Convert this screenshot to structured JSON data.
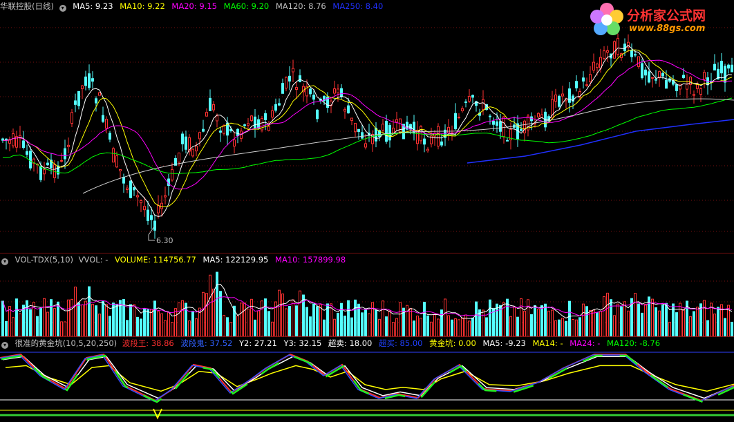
{
  "price_pane": {
    "title": "华联控股(日线)",
    "ma_labels": [
      {
        "text": "MA5: 9.23",
        "color": "#ffffff"
      },
      {
        "text": "MA10: 9.22",
        "color": "#ffff00"
      },
      {
        "text": "MA20: 9.15",
        "color": "#ff00ff"
      },
      {
        "text": "MA60: 9.20",
        "color": "#00ff00"
      },
      {
        "text": "MA120: 8.76",
        "color": "#c0c0c0"
      },
      {
        "text": "MA250: 8.40",
        "color": "#0000ff"
      }
    ],
    "low_marker": "6.30"
  },
  "logo": {
    "name": "分析家公式网",
    "url": "www.88gs.com"
  },
  "volume_pane": {
    "title": "VOL-TDX(5,10)",
    "labels": [
      {
        "text": "VVOL: -",
        "color": "#c0c0c0"
      },
      {
        "text": "VOLUME: 114756.77",
        "color": "#ffff00"
      },
      {
        "text": "MA5: 122129.95",
        "color": "#ffffff"
      },
      {
        "text": "MA10: 157899.98",
        "color": "#ff00ff"
      }
    ]
  },
  "indicator_pane": {
    "title": "很准的黄金坑(10,5,20,250)",
    "labels": [
      {
        "text": "波段王: 38.86",
        "color": "#ff3030"
      },
      {
        "text": "波段鬼: 37.52",
        "color": "#3060ff"
      },
      {
        "text": "Y2: 27.21",
        "color": "#ffffff"
      },
      {
        "text": "Y3: 32.15",
        "color": "#ffffff"
      },
      {
        "text": "超卖: 18.00",
        "color": "#ffffff"
      },
      {
        "text": "超买: 85.00",
        "color": "#2040ff"
      },
      {
        "text": "黄金坑: 0.00",
        "color": "#ffff00"
      },
      {
        "text": "MA5: -9.23",
        "color": "#ffffff"
      },
      {
        "text": "MA14: -",
        "color": "#ffff00"
      },
      {
        "text": "MA24: -",
        "color": "#ff00ff"
      },
      {
        "text": "MA120: -8.76",
        "color": "#00ff00"
      }
    ]
  },
  "colors": {
    "up": "#ff3232",
    "down": "#54ffff",
    "grid": "#7a1010"
  }
}
